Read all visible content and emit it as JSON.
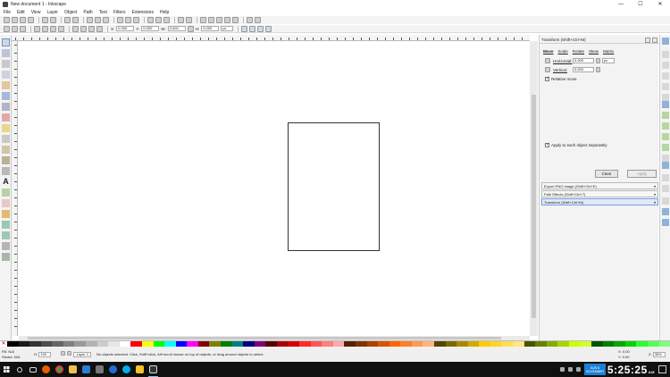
{
  "window": {
    "title": "New document 1 - Inkscape",
    "controls": [
      "—",
      "☐",
      "✕"
    ]
  },
  "menu": [
    "File",
    "Edit",
    "View",
    "Layer",
    "Object",
    "Path",
    "Text",
    "Filters",
    "Extensions",
    "Help"
  ],
  "toolcontrols": {
    "x_label": "X:",
    "x_value": "0.000",
    "y_label": "Y:",
    "y_value": "0.000",
    "w_label": "W:",
    "w_value": "0.000",
    "h_label": "H:",
    "h_value": "0.000",
    "unit": "px"
  },
  "dock": {
    "title": "Transform (Shift+Ctrl+M)",
    "tabs": [
      "Move",
      "Scale",
      "Rotate",
      "Skew",
      "Matrix"
    ],
    "horizontal_label": "Horizontal:",
    "horizontal_value": "0.000",
    "unit": "px",
    "vertical_label": "Vertical:",
    "vertical_value": "0.000",
    "relative_move": "Relative move",
    "apply_each": "Apply to each object separately",
    "clear": "Clear",
    "apply": "Apply",
    "dialogs": [
      "Export PNG Image (Shift+Ctrl+E)",
      "Path Effects (Shift+Ctrl+7)",
      "Transform (Shift+Ctrl+M)"
    ]
  },
  "status": {
    "fill_label": "Fill:",
    "fill_value": "N/A",
    "stroke_label": "Stroke:",
    "stroke_value": "N/A",
    "opacity_label": "O:",
    "opacity_value": "100",
    "layer": "-Layer 1",
    "message": "No objects selected. Click, Shift+click, Alt+scroll mouse on top of objects, or drag around objects to select.",
    "x_label": "X:",
    "x_value": "0.00",
    "y_label": "Y:",
    "y_value": "0.00",
    "zoom_label": "Z:",
    "zoom_value": "35%"
  },
  "taskbar": {
    "clock_line1": "SUN 8",
    "clock_line2": "NOVEMBER",
    "time": "5:25:25",
    "ampm": "AM"
  },
  "colors": {
    "accent": "#1c7fd6",
    "palette": [
      "#000000",
      "#1a1a1a",
      "#333333",
      "#4d4d4d",
      "#666666",
      "#808080",
      "#999999",
      "#b3b3b3",
      "#cccccc",
      "#e6e6e6",
      "#ffffff",
      "#ff0000",
      "#ffff00",
      "#00ff00",
      "#00ffff",
      "#0000ff",
      "#ff00ff",
      "#800000",
      "#808000",
      "#008000",
      "#008080",
      "#000080",
      "#800080",
      "#550000",
      "#aa0000",
      "#d40000",
      "#ff2a2a",
      "#ff5555",
      "#ff8080",
      "#ffaaaa",
      "#552200",
      "#803300",
      "#aa4400",
      "#d45500",
      "#ff6600",
      "#ff7f2a",
      "#ff9955",
      "#ffb380",
      "#554400",
      "#806600",
      "#aa8800",
      "#d4aa00",
      "#ffcc00",
      "#ffd42a",
      "#ffdd55",
      "#ffe680",
      "#445500",
      "#668000",
      "#88aa00",
      "#aad400",
      "#ccff00",
      "#d4ff2a",
      "#005500",
      "#008000",
      "#00aa00",
      "#00d400",
      "#2aff2a",
      "#55ff55",
      "#80ff80"
    ]
  }
}
